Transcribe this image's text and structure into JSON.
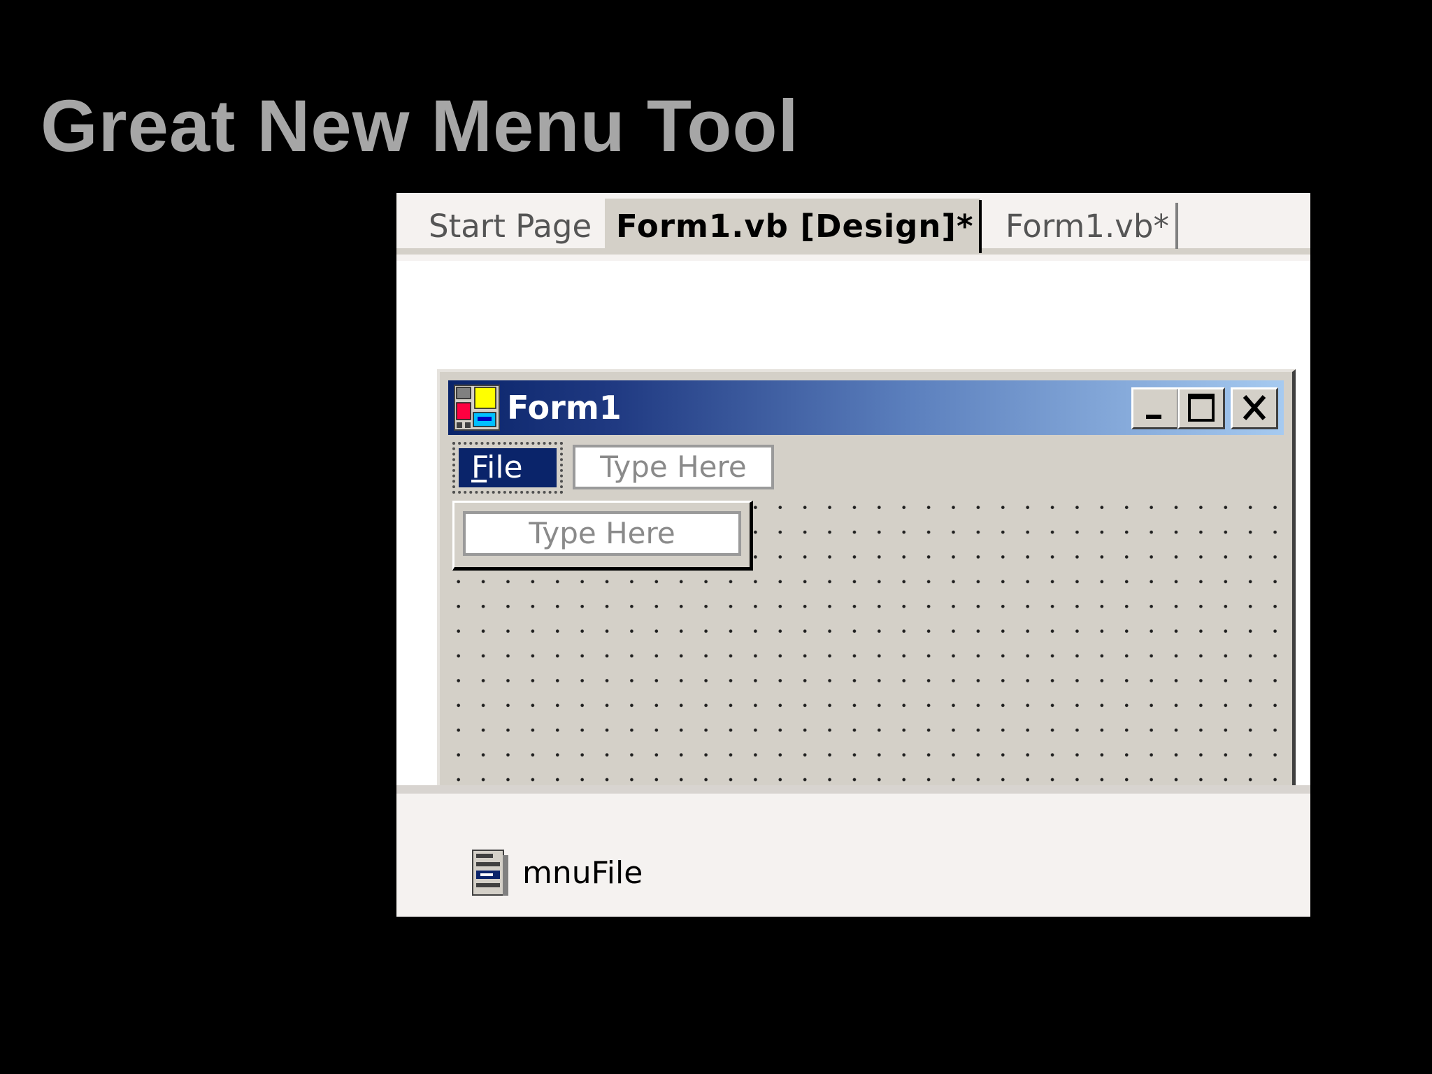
{
  "slide": {
    "title": "Great New Menu Tool"
  },
  "tabs": [
    {
      "label": "Start Page",
      "active": false
    },
    {
      "label": "Form1.vb [Design]*",
      "active": true
    },
    {
      "label": "Form1.vb*",
      "active": false
    }
  ],
  "form": {
    "title": "Form1",
    "controls": {
      "minimize_icon": "minimize-icon",
      "maximize_icon": "maximize-icon",
      "close_icon": "close-icon"
    }
  },
  "menu": {
    "file_label_underlined": "F",
    "file_label_rest": "ile",
    "type_here_top": "Type Here",
    "type_here_dropdown": "Type Here"
  },
  "tray": {
    "component_label": "mnuFile",
    "component_icon": "main-menu-component-icon"
  },
  "colors": {
    "background": "#000000",
    "title_text": "#a6a6a6",
    "titlebar_start": "#0a246a",
    "titlebar_end": "#a6caf0",
    "form_face": "#d4d0c8",
    "selection": "#0a246a"
  }
}
